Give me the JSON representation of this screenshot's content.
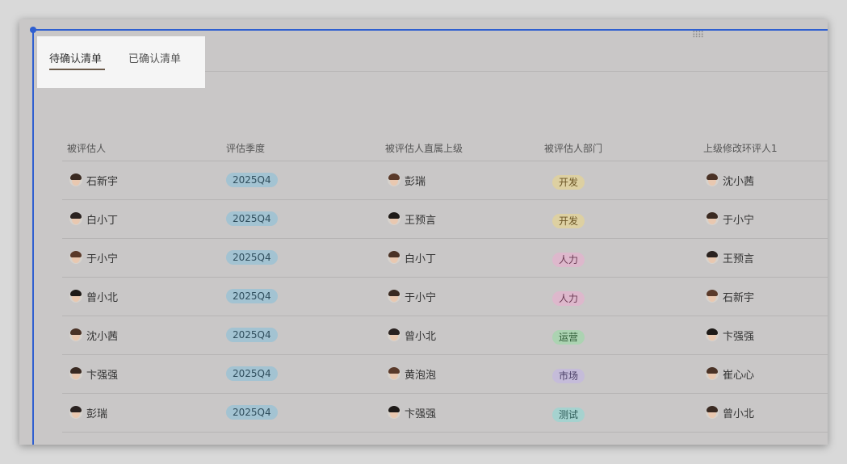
{
  "tabs": [
    {
      "label": "待确认清单",
      "active": true
    },
    {
      "label": "已确认清单",
      "active": false
    }
  ],
  "columns": [
    "被评估人",
    "评估季度",
    "被评估人直属上级",
    "被评估人部门",
    "上级修改环评人1"
  ],
  "dept_colors": {
    "开发": "d-kf",
    "人力": "d-rl",
    "运营": "d-yy",
    "市场": "d-sc",
    "测试": "d-cs"
  },
  "rows": [
    {
      "person": "石新宇",
      "quarter": "2025Q4",
      "manager": "彭瑞",
      "dept": "开发",
      "reviewer": "沈小茜"
    },
    {
      "person": "白小丁",
      "quarter": "2025Q4",
      "manager": "王预言",
      "dept": "开发",
      "reviewer": "于小宁"
    },
    {
      "person": "于小宁",
      "quarter": "2025Q4",
      "manager": "白小丁",
      "dept": "人力",
      "reviewer": "王预言"
    },
    {
      "person": "曾小北",
      "quarter": "2025Q4",
      "manager": "于小宁",
      "dept": "人力",
      "reviewer": "石新宇"
    },
    {
      "person": "沈小茜",
      "quarter": "2025Q4",
      "manager": "曾小北",
      "dept": "运营",
      "reviewer": "卞强强"
    },
    {
      "person": "卞强强",
      "quarter": "2025Q4",
      "manager": "黄泡泡",
      "dept": "市场",
      "reviewer": "崔心心"
    },
    {
      "person": "彭瑞",
      "quarter": "2025Q4",
      "manager": "卞强强",
      "dept": "测试",
      "reviewer": "曾小北"
    }
  ]
}
